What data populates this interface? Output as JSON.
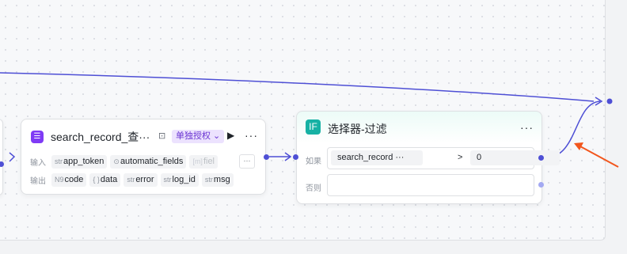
{
  "colors": {
    "wire": "#4e4fd5",
    "annotation_arrow": "#f2561d",
    "app_icon": "#7f3bf5",
    "if_icon": "#16b1a4",
    "auth_tag": "#6a34d2"
  },
  "search_node": {
    "app_icon": "list-app-icon",
    "title": "search_record_查···",
    "bot_icon": "bot-icon",
    "auth_tag": "单独授权",
    "run_icon": "play-icon",
    "more": "···",
    "input_label": "输入",
    "inputs": [
      {
        "type": "str",
        "name": "app_token"
      },
      {
        "type": "⊙",
        "name": "automatic_fields"
      },
      {
        "type": "[m]",
        "name": "fiel"
      }
    ],
    "inputs_more": "···",
    "output_label": "输出",
    "outputs": [
      {
        "type": "N9",
        "name": "code"
      },
      {
        "type": "{ }",
        "name": "data"
      },
      {
        "type": "str",
        "name": "error"
      },
      {
        "type": "str",
        "name": "log_id"
      },
      {
        "type": "str",
        "name": "msg"
      }
    ]
  },
  "filter_node": {
    "icon_text": "IF",
    "title": "选择器-过滤",
    "more": "···",
    "if_label": "如果",
    "condition": {
      "field": "search_record  ···",
      "operator": ">",
      "value": "0"
    },
    "else_label": "否则"
  }
}
